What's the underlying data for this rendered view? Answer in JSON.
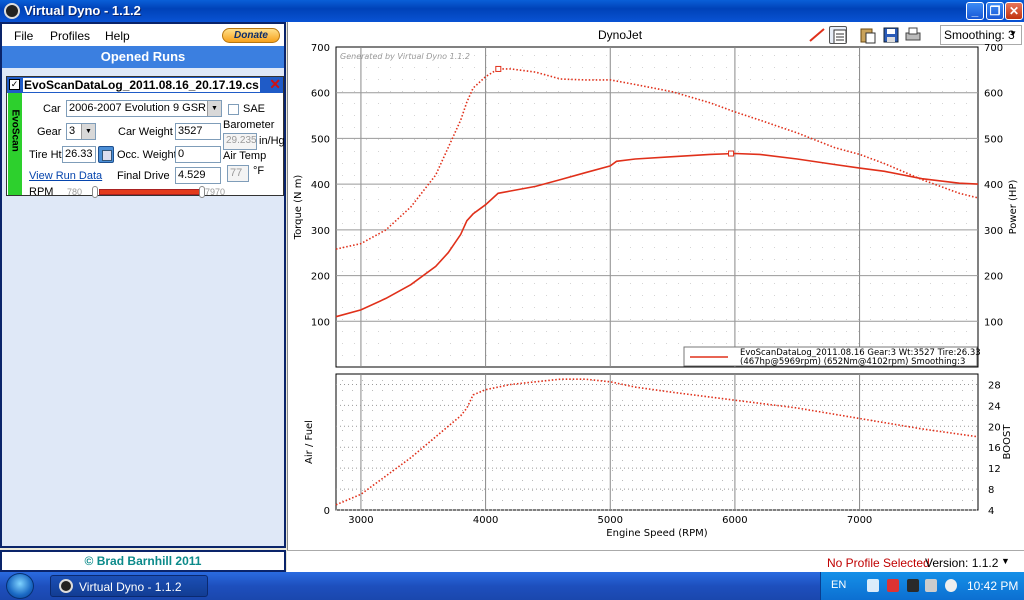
{
  "window": {
    "title": "Virtual Dyno - 1.1.2"
  },
  "menu": {
    "file": "File",
    "profiles": "Profiles",
    "help": "Help",
    "donate": "Donate"
  },
  "panel": {
    "heading": "Opened Runs",
    "copyright": "© Brad Barnhill 2011"
  },
  "run": {
    "name": "EvoScanDataLog_2011.08.16_20.17.19.cs",
    "checked": "✓",
    "tag": "EvoScan",
    "car_label": "Car",
    "car_value": "2006-2007 Evolution 9 GSR",
    "sae_label": "SAE",
    "gear_label": "Gear",
    "gear_value": "3",
    "car_weight_label": "Car Weight",
    "car_weight_value": "3527",
    "barometer_label": "Barometer",
    "barometer_value": "29.235",
    "barometer_unit": "in/Hg",
    "tire_label": "Tire Ht",
    "tire_value": "26.33",
    "occ_weight_label": "Occ. Weight",
    "occ_weight_value": "0",
    "air_temp_label": "Air Temp",
    "air_temp_value": "77",
    "air_temp_unit": "°F",
    "view_link": "View Run Data",
    "final_drive_label": "Final Drive",
    "final_drive_value": "4.529",
    "rpm_label": "RPM",
    "rpm_min": "780",
    "rpm_max": "7970"
  },
  "chart_toolbar": {
    "title": "DynoJet",
    "smoothing": "Smoothing: 3"
  },
  "status": {
    "profile": "No Profile Selected",
    "version": "Version: 1.1.2"
  },
  "taskbar": {
    "task": "Virtual Dyno - 1.1.2",
    "lang": "EN",
    "clock": "10:42 PM"
  },
  "colors": {
    "series": "#e0301a",
    "panel_blue": "#3b7fe0",
    "tag_green": "#2dd02d"
  },
  "chart_data": [
    {
      "type": "line",
      "watermark": "Generated by Virtual Dyno 1.1.2",
      "xlabel": "Engine Speed (RPM)",
      "ylabel": "Torque (N m)",
      "y2label": "Power (HP)",
      "xlim": [
        2800,
        7950
      ],
      "ylim": [
        0,
        700
      ],
      "x_ticks": [
        3000,
        4000,
        5000,
        6000,
        7000
      ],
      "y_ticks": [
        100,
        200,
        300,
        400,
        500,
        600,
        700
      ],
      "y2_ticks": [
        100,
        200,
        300,
        400,
        500,
        600,
        700
      ],
      "legend": {
        "line1": "EvoScanDataLog_2011.08.16 Gear:3 Wt:3527 Tire:26.33",
        "line2": "(467hp@5969rpm) (652Nm@4102rpm) Smoothing:3",
        "position": "bottom-right"
      },
      "series": [
        {
          "name": "Power (HP)",
          "style": "solid",
          "x": [
            2800,
            3000,
            3200,
            3400,
            3600,
            3700,
            3800,
            3850,
            3900,
            4000,
            4100,
            4200,
            4400,
            4600,
            4800,
            5000,
            5050,
            5200,
            5500,
            5800,
            6000,
            6200,
            6500,
            6800,
            7000,
            7200,
            7500,
            7800,
            7950
          ],
          "y": [
            110,
            125,
            150,
            180,
            220,
            250,
            290,
            320,
            335,
            355,
            380,
            385,
            395,
            410,
            425,
            440,
            450,
            455,
            460,
            465,
            467,
            465,
            455,
            443,
            435,
            428,
            412,
            402,
            400
          ],
          "marker": {
            "x": 5969,
            "y": 467
          }
        },
        {
          "name": "Torque (N m)",
          "style": "dotted",
          "x": [
            2800,
            3000,
            3200,
            3400,
            3600,
            3700,
            3800,
            3850,
            3900,
            4000,
            4100,
            4200,
            4400,
            4600,
            4800,
            5000,
            5200,
            5500,
            5800,
            6000,
            6200,
            6500,
            6800,
            7000,
            7200,
            7500,
            7800,
            7950
          ],
          "y": [
            258,
            270,
            300,
            350,
            420,
            480,
            540,
            580,
            610,
            635,
            652,
            652,
            645,
            630,
            628,
            628,
            618,
            602,
            578,
            558,
            540,
            512,
            480,
            465,
            445,
            410,
            380,
            370
          ],
          "marker": {
            "x": 4102,
            "y": 652
          }
        }
      ]
    },
    {
      "type": "line",
      "ylabel": "Air / Fuel",
      "y2label": "BOOST",
      "xlim": [
        2800,
        7950
      ],
      "ylim": [
        4,
        30
      ],
      "y_ticks": [
        0
      ],
      "y2_ticks": [
        4,
        8,
        12,
        16,
        20,
        24,
        28
      ],
      "series": [
        {
          "name": "BOOST",
          "style": "dotted",
          "x": [
            2800,
            3000,
            3200,
            3400,
            3600,
            3800,
            3850,
            3900,
            4000,
            4200,
            4400,
            4600,
            4800,
            5000,
            5200,
            5500,
            6000,
            6500,
            7000,
            7500,
            7950
          ],
          "y": [
            5,
            7,
            10.5,
            14,
            18,
            22,
            23.5,
            26,
            27,
            28,
            28.5,
            29,
            29,
            28.5,
            27.5,
            26.5,
            25,
            23.5,
            21.5,
            19.5,
            18
          ]
        }
      ]
    }
  ]
}
